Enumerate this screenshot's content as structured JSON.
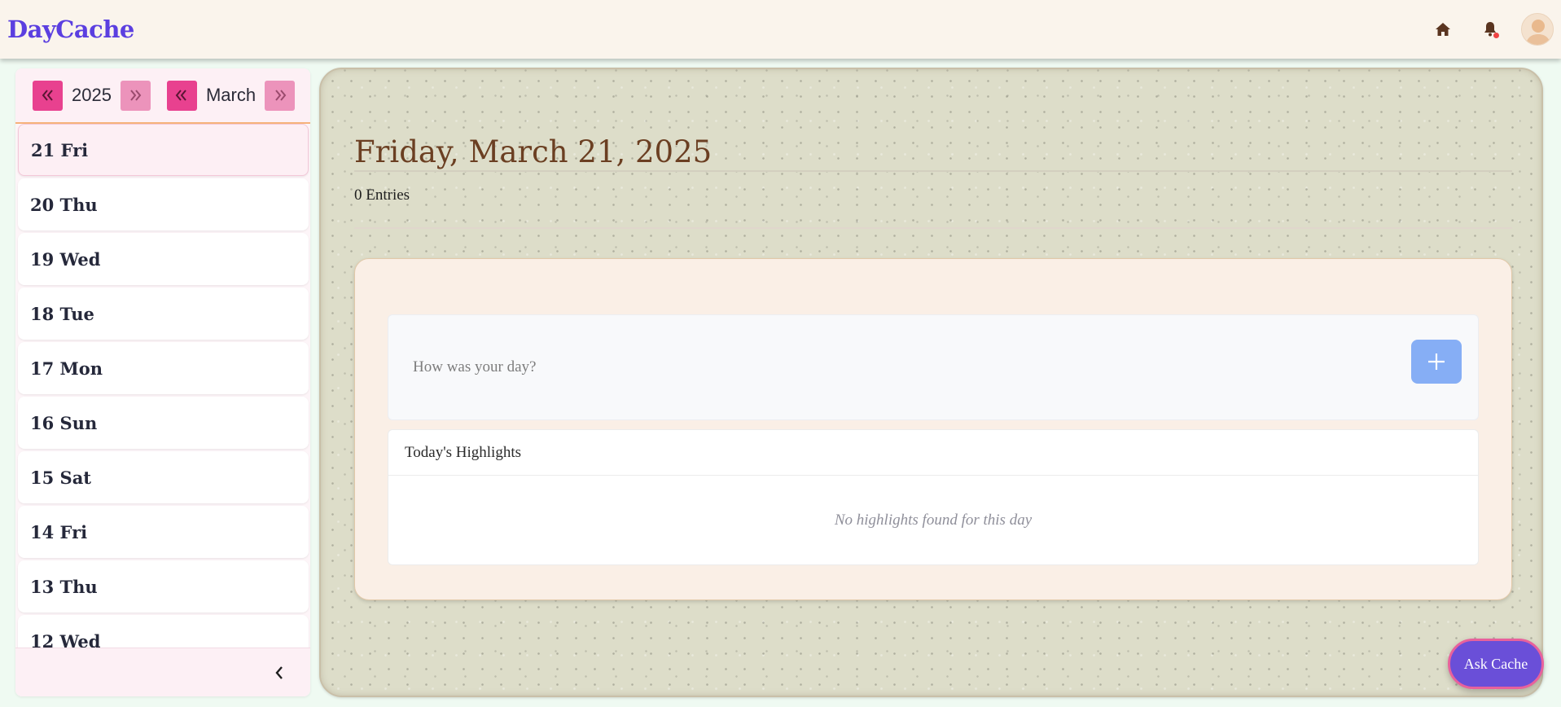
{
  "app": {
    "brand": "DayCache"
  },
  "header": {
    "icons": [
      "home-icon",
      "bell-icon",
      "avatar"
    ]
  },
  "sidebar": {
    "year": "2025",
    "month": "March",
    "days": [
      {
        "label": "21 Fri",
        "active": true
      },
      {
        "label": "20 Thu",
        "active": false
      },
      {
        "label": "19 Wed",
        "active": false
      },
      {
        "label": "18 Tue",
        "active": false
      },
      {
        "label": "17 Mon",
        "active": false
      },
      {
        "label": "16 Sun",
        "active": false
      },
      {
        "label": "15 Sat",
        "active": false
      },
      {
        "label": "14 Fri",
        "active": false
      },
      {
        "label": "13 Thu",
        "active": false
      },
      {
        "label": "12 Wed",
        "active": false
      }
    ]
  },
  "main": {
    "date_title": "Friday, March 21, 2025",
    "entries_count": "0 Entries",
    "entry": {
      "placeholder": "How was your day?",
      "value": ""
    },
    "highlights": {
      "title": "Today's Highlights",
      "empty_text": "No highlights found for this day"
    }
  },
  "ask_button": "Ask Cache",
  "colors": {
    "brand": "#5b3fe0",
    "nav_button": "#e8418f",
    "add_button": "#86aef5",
    "ask_button": "#6a4fd8",
    "title": "#6b3f22"
  }
}
